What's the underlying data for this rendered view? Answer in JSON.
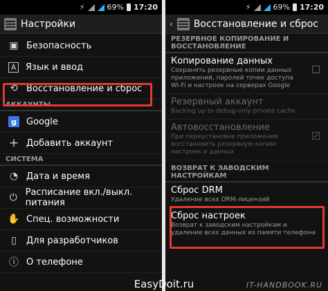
{
  "status": {
    "usb": "⚡",
    "battery": "69%",
    "time": "17:20"
  },
  "left": {
    "title": "Настройки",
    "items_top": [
      {
        "label": "Безопасность",
        "icon": "lock-icon"
      },
      {
        "label": "Язык и ввод",
        "icon": "keyboard-icon"
      },
      {
        "label": "Восстановление и сброс",
        "icon": "restore-icon"
      }
    ],
    "section_accounts": "АККАУНТЫ",
    "accounts": [
      {
        "label": "Google",
        "icon": "google-icon"
      },
      {
        "label": "Добавить аккаунт",
        "icon": "plus-icon"
      }
    ],
    "section_system": "СИСТЕМА",
    "system": [
      {
        "label": "Дата и время",
        "icon": "clock-icon"
      },
      {
        "label": "Расписание вкл./выкл. питания",
        "icon": "power-schedule-icon"
      },
      {
        "label": "Спец. возможности",
        "icon": "accessibility-icon"
      },
      {
        "label": "Для разработчиков",
        "icon": "developer-icon"
      },
      {
        "label": "О телефоне",
        "icon": "info-icon"
      }
    ]
  },
  "right": {
    "title": "Восстановление и сброс",
    "section_backup": "РЕЗЕРВНОЕ КОПИРОВАНИЕ И ВОССТАНОВЛЕНИЕ",
    "backup": {
      "title": "Копирование данных",
      "desc": "Сохранять резервные копии данных приложений, паролей точек доступа Wi-Fi и настроек на серверах Google"
    },
    "backup_account": {
      "title": "Резервный аккаунт",
      "desc": "Backing up to debug-only private cache"
    },
    "auto_restore": {
      "title": "Автовосстановление",
      "desc": "При переустановке приложения восстановить резервную копию настроек и данных"
    },
    "section_factory": "ВОЗВРАТ К ЗАВОДСКИМ НАСТРОЙКАМ",
    "drm": {
      "title": "Сброс DRM",
      "desc": "Удаление всех DRM-лицензий"
    },
    "factory": {
      "title": "Сброс настроек",
      "desc": "Возврат к заводским настройкам и удаление всех данных из памяти телефона"
    }
  },
  "watermark": {
    "main": "EasyDoit.ru",
    "secondary": "IT-HANDBOOK.RU"
  },
  "colors": {
    "highlight": "#e53935",
    "signal": "#29b6f6"
  }
}
